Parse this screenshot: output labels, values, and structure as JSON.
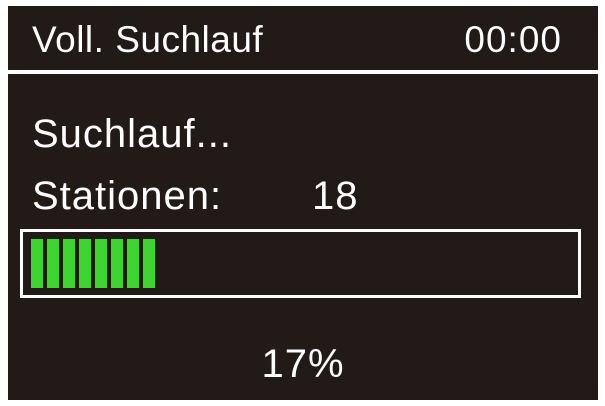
{
  "header": {
    "title": "Voll. Suchlauf",
    "clock": "00:00"
  },
  "scan": {
    "status": "Suchlauf...",
    "stations_label": "Stationen:",
    "stations_count": "18",
    "progress_fraction": 0.17,
    "progress_percent": "17%",
    "segments_lit": 8
  },
  "colors": {
    "screen_background": "#211a17",
    "text": "#ffffff",
    "progress_fill": "#3fd531"
  }
}
